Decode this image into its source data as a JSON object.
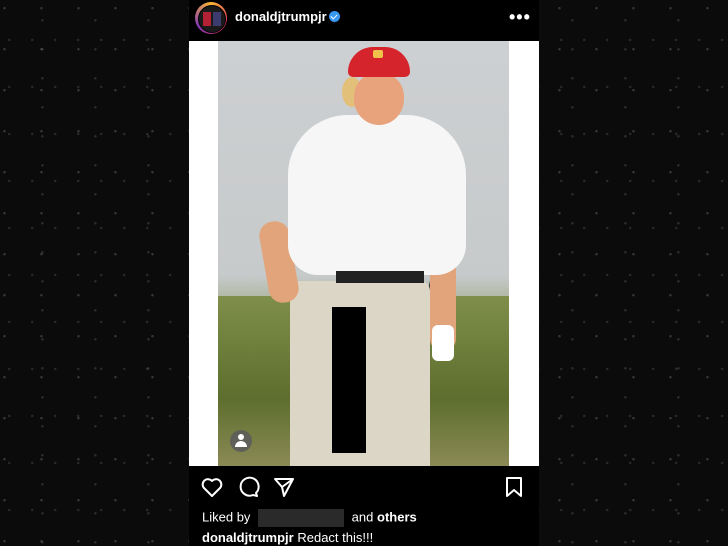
{
  "post": {
    "username": "donaldjtrumpjr",
    "more_icon": "more-dots-icon",
    "verified_icon": "verified-badge-icon",
    "accent_color": "#3897f0"
  },
  "likes": {
    "prefix": "Liked by",
    "connector": "and",
    "suffix": "others"
  },
  "caption": {
    "author": "donaldjtrumpjr",
    "text": "Redact this!!!"
  },
  "actions": {
    "like_icon": "heart-icon",
    "comment_icon": "comment-icon",
    "share_icon": "share-icon",
    "save_icon": "bookmark-icon"
  }
}
